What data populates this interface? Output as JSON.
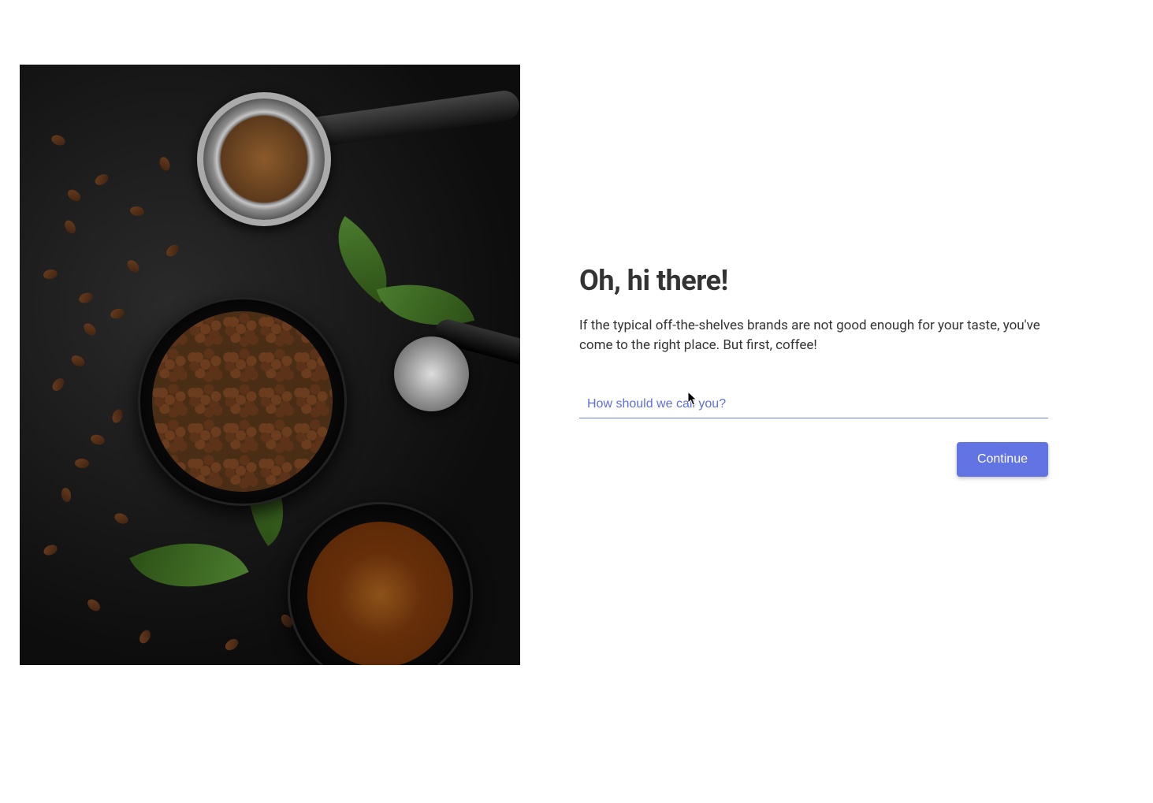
{
  "form": {
    "heading": "Oh, hi there!",
    "description": "If the typical off-the-shelves brands are not good enough for your taste, you've come to the right place. But first, coffee!",
    "name_input": {
      "placeholder": "How should we call you?",
      "value": ""
    },
    "continue_label": "Continue"
  },
  "image": {
    "alt": "Coffee beans, ground coffee, portafilter, tamper and green leaves on dark surface"
  }
}
